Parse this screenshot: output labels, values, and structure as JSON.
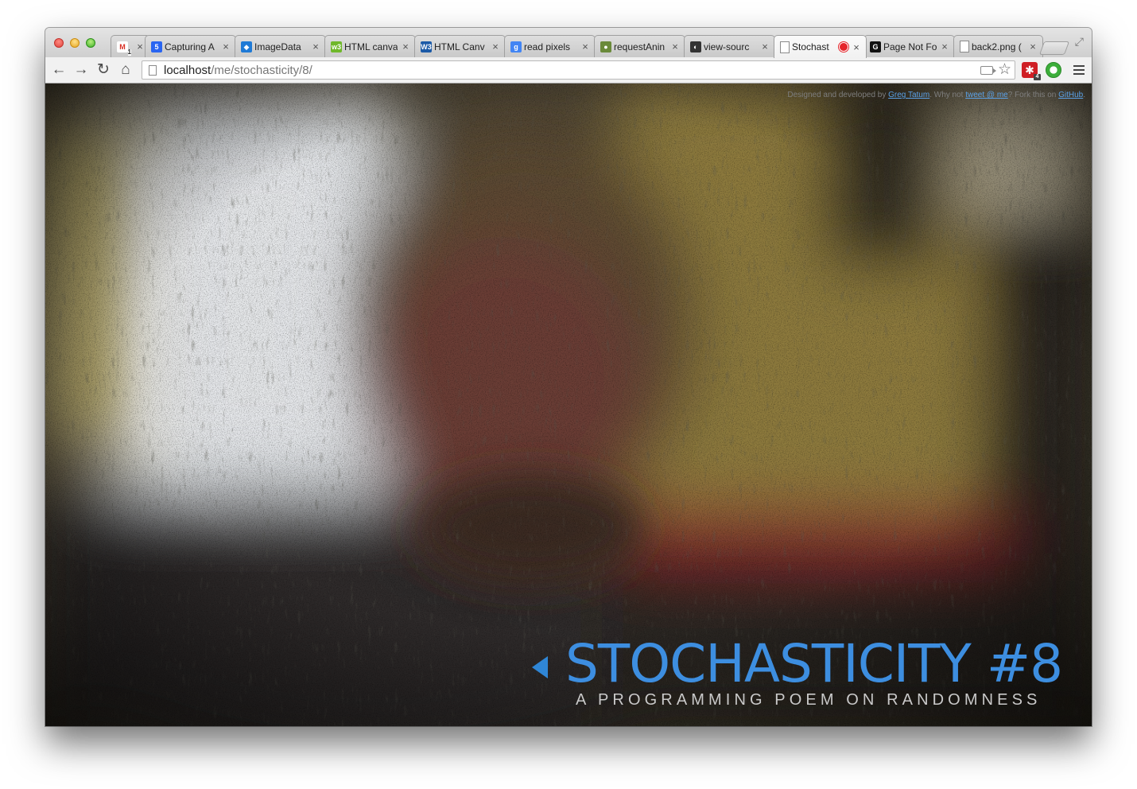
{
  "browser": {
    "tabs": [
      {
        "label": "",
        "favicon": "gmail-icon",
        "favicon_text": "M",
        "favicon_color": "#d93025",
        "active": false
      },
      {
        "label": "Capturing A",
        "favicon": "css3-icon",
        "favicon_text": "5",
        "favicon_color": "#2965f1",
        "active": false
      },
      {
        "label": "ImageData",
        "favicon": "mdn-icon",
        "favicon_text": "◆",
        "favicon_color": "#1f7ad6",
        "active": false
      },
      {
        "label": "HTML canva",
        "favicon": "w3schools-icon",
        "favicon_text": "w3",
        "favicon_color": "#6fb82a",
        "active": false
      },
      {
        "label": "HTML Canv",
        "favicon": "w3c-icon",
        "favicon_text": "W3",
        "favicon_color": "#1b5aa7",
        "active": false
      },
      {
        "label": "read pixels",
        "favicon": "google-icon",
        "favicon_text": "g",
        "favicon_color": "#4285f4",
        "active": false
      },
      {
        "label": "requestAnin",
        "favicon": "avatar-icon",
        "favicon_text": "●",
        "favicon_color": "#6a8a3a",
        "active": false
      },
      {
        "label": "view-sourc",
        "favicon": "github-icon",
        "favicon_text": "◐",
        "favicon_color": "#333333",
        "active": false
      },
      {
        "label": "Stochast",
        "favicon": "page-icon",
        "favicon_text": "",
        "favicon_color": "#ffffff",
        "active": true,
        "recording": true
      },
      {
        "label": "Page Not Fo",
        "favicon": "g-icon",
        "favicon_text": "G",
        "favicon_color": "#111111",
        "active": false
      },
      {
        "label": "back2.png (",
        "favicon": "page-icon",
        "favicon_text": "",
        "favicon_color": "#ffffff",
        "active": false
      }
    ],
    "close_glyph": "×",
    "gmail_badge": "1",
    "url_host": "localhost",
    "url_path": "/me/stochasticity/8/",
    "ext_badge": "4"
  },
  "page": {
    "credits": {
      "prefix": "Designed and developed by ",
      "author": "Greg Tatum",
      "middle1": ". Why not ",
      "tweet": "tweet @ me",
      "middle2": "? Fork this on ",
      "github": "GitHub",
      "suffix": "."
    },
    "title": "STOCHASTICITY #8",
    "subtitle": "A PROGRAMMING POEM ON RANDOMNESS",
    "colors": {
      "title": "#3d8ee0",
      "subtitle": "#c9c9c9",
      "link": "#5aa0e6"
    }
  }
}
